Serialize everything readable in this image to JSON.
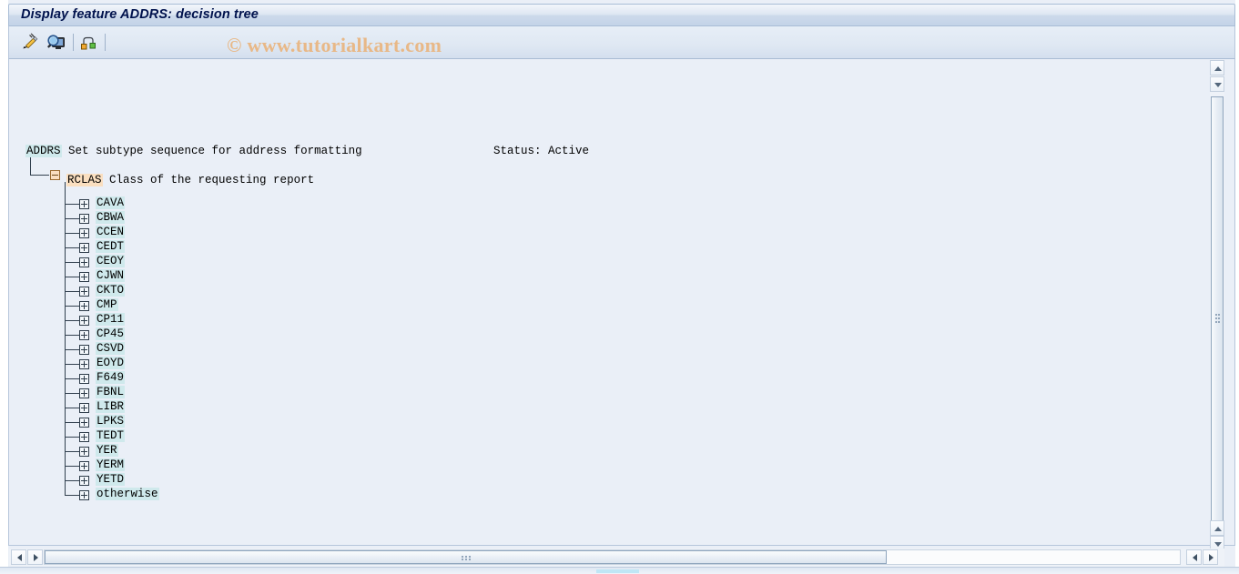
{
  "window": {
    "title": "Display feature ADDRS: decision tree"
  },
  "toolbar": {
    "buttons": [
      {
        "name": "change-pencil-icon",
        "tooltip": "Change"
      },
      {
        "name": "display-magnifier-icon",
        "tooltip": "Display"
      },
      {
        "name": "tree-structure-icon",
        "tooltip": "Structure"
      }
    ]
  },
  "watermark": {
    "text": "© www.tutorialkart.com"
  },
  "tree": {
    "root": {
      "code": "ADDRS",
      "description": "Set subtype sequence for address formatting",
      "status_label": "Status: Active"
    },
    "branch": {
      "code": "RCLAS",
      "description": "Class of the requesting report",
      "expanded": true
    },
    "children": [
      {
        "label": "CAVA"
      },
      {
        "label": "CBWA"
      },
      {
        "label": "CCEN"
      },
      {
        "label": "CEDT"
      },
      {
        "label": "CEOY"
      },
      {
        "label": "CJWN"
      },
      {
        "label": "CKTO"
      },
      {
        "label": "CMP"
      },
      {
        "label": "CP11"
      },
      {
        "label": "CP45"
      },
      {
        "label": "CSVD"
      },
      {
        "label": "EOYD"
      },
      {
        "label": "F649"
      },
      {
        "label": "FBNL"
      },
      {
        "label": "LIBR"
      },
      {
        "label": "LPKS"
      },
      {
        "label": "TEDT"
      },
      {
        "label": "YER"
      },
      {
        "label": "YERM"
      },
      {
        "label": "YETD"
      },
      {
        "label": "otherwise"
      }
    ]
  },
  "colors": {
    "highlight_cyan": "#cfe9ec",
    "highlight_orange": "#fadfc0",
    "title_text": "#00124d",
    "watermark": "#e8b887",
    "panel_bg": "#eaeff7"
  }
}
